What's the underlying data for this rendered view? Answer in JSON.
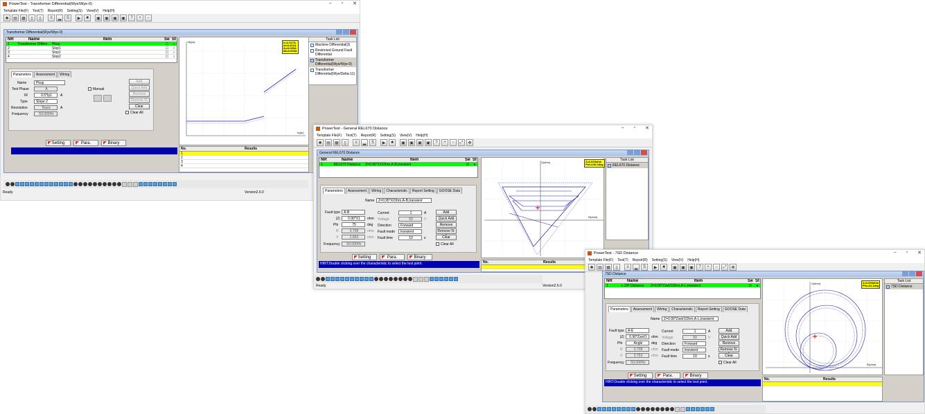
{
  "win1": {
    "title": "PowerTest - Transformer Differential(Wye/Wye-0)",
    "menu": [
      "Template File(F)",
      "Test(T)",
      "Report(R)",
      "Setting(S)",
      "View(V)",
      "Help(H)"
    ],
    "mdi_title": "Transformer Differential(Wye/Wye-0)",
    "grid_headers": {
      "nr": "NR",
      "name": "Name",
      "item": "Item",
      "sel": "Sel",
      "st": "St"
    },
    "rows": [
      {
        "nr": "1",
        "name": "Transformer Differe...",
        "item": "Pkup"
      },
      {
        "nr": "2",
        "name": "",
        "item": "Slop1"
      },
      {
        "nr": "3",
        "name": "",
        "item": "Slop1"
      },
      {
        "nr": "4",
        "name": "",
        "item": "Slop2"
      }
    ],
    "tabs": [
      "Parameters",
      "Assessment",
      "Wiring"
    ],
    "fields": {
      "name_label": "Name",
      "name_val": "Pkup",
      "phase_label": "Test Phase",
      "phase_val": "A",
      "ir_label": "IR",
      "ir_val": "0.5*Ip1",
      "ir_unit": "A",
      "type_label": "Type",
      "type_val": "Slope 2",
      "res_label": "Resolution",
      "res_val": "Basic",
      "res_unit": "A",
      "freq_label": "Frequency",
      "freq_val": "50.000Hz",
      "manual": "Manual",
      "clearall": "Clear All"
    },
    "btns": [
      "Add",
      "Quick Add",
      "Remove",
      "Remove N-1",
      "Clear"
    ],
    "bottom": [
      "Setting",
      "Para.",
      "Binary"
    ],
    "results": {
      "no": "No.",
      "res": "Results",
      "rows": [
        "1",
        "2",
        "3",
        "4"
      ]
    },
    "tasklist": {
      "title": "Task List",
      "items": [
        "Machine Differential(3)",
        "Restricted Ground Fault Differential",
        "Transformer Differential(Wye/Wye-0)",
        "Transformer Differential(Wye/Delta-11)"
      ]
    },
    "legend": [
      "Ir=2.017A",
      "Id=0.611A",
      "Ih=0.000A",
      "IM=0.000A"
    ],
    "chart": {
      "ylabel": "Id(pu)",
      "xlabel": "Ir(pu)",
      "xticks": [
        "0.0",
        "0.5",
        "1.0",
        "1.5",
        "2.0",
        "2.5",
        "3.0",
        "3.5"
      ],
      "yticks": [
        "3.5",
        "3.0",
        "2.5",
        "2.0",
        "1.5",
        "1.0",
        "0.5"
      ]
    },
    "status": "Ready",
    "version": "Version2.6.0"
  },
  "win2": {
    "title": "PowerTest - General REL670 Distance",
    "menu": [
      "Template File(F)",
      "Test(T)",
      "Report(R)",
      "Setting(S)",
      "View(V)",
      "Help(H)"
    ],
    "mdi_title": "General REL670 Distance",
    "row": {
      "nr": "1",
      "name": "REL670 Distance",
      "item": "Z=0.95*1X/Ohm,A-B,transient"
    },
    "tabs": [
      "Parameters",
      "Assessment",
      "Wiring",
      "Characteristic",
      "Report Setting",
      "GOOSE Data"
    ],
    "name_label": "Name",
    "name_val": "Z=0.95*X/Ohm,A-B,transient",
    "labels": {
      "fault": "Fault type",
      "z": "|Z|",
      "phi": "Phi",
      "r": "R",
      "x": "X",
      "freq": "Frequency",
      "current": "Current",
      "voltage": "Voltage",
      "direction": "Direction",
      "mode": "Fault mode",
      "time": "Fault time",
      "clearall": "Clear All"
    },
    "vals": {
      "fault": "A-B",
      "z": "0.90*X1",
      "phi": "75",
      "r": "0.708",
      "x": "2.653",
      "freq": "50.000Hz",
      "current": "1",
      "voltage": "50",
      "direction": "Forward",
      "mode": "transient",
      "time": "10"
    },
    "units": {
      "z": "ohm",
      "phi": "deg",
      "r": "ohm",
      "x": "ohm",
      "current": "A",
      "voltage": "V",
      "time": "s"
    },
    "btns": [
      "Add",
      "Quick Add",
      "Remove",
      "Remove N-1",
      "Clear"
    ],
    "bottom": [
      "Setting",
      "Para.",
      "Binary"
    ],
    "hint": "HINT:Double clicking over the characteristic to select the test point.",
    "results": {
      "no": "No.",
      "res": "Results"
    },
    "tasklist": {
      "title": "Task List",
      "items": [
        "REL670 Distance"
      ]
    },
    "legend": [
      "Z=2.620ohm",
      "Phi=140.0deg"
    ],
    "xlabel": "R(ohm)",
    "ylabel": "X(ohm)",
    "status": "Ready",
    "version": "Version2.6.0"
  },
  "win3": {
    "title": "PowerTest - 7SD Distance",
    "menu": [
      "Template File(F)",
      "Test(T)",
      "Report(R)",
      "Setting(S)",
      "View(V)",
      "Help(H)"
    ],
    "mdi_title": "7SD Distance",
    "row": {
      "nr": "1",
      "name": "L-Z/P Distance",
      "item": "Z=0.90*Zset/1Ohm,A-L,transient"
    },
    "tabs": [
      "Parameters",
      "Assessment",
      "Wiring",
      "Characteristic",
      "Report Setting",
      "GOOSE Data"
    ],
    "name_label": "Name",
    "name_val": "Z=0.90*Zset/1Ohm,A-L,transient",
    "labels": {
      "fault": "Fault type",
      "z": "|Z|",
      "phi": "Phi",
      "r": "R",
      "x": "X",
      "freq": "Frequency",
      "current": "Current",
      "voltage": "Voltage",
      "direction": "Direction",
      "mode": "Fault mode",
      "time": "Fault time",
      "clearall": "Clear All"
    },
    "vals": {
      "fault": "A-E",
      "z": "0.90*Zset/1",
      "phi": "Angle",
      "r": "0.708",
      "x": "2.753",
      "freq": "50.000Hz",
      "current": "1",
      "voltage": "50",
      "direction": "Forward",
      "mode": "transient",
      "time": "10"
    },
    "units": {
      "z": "ohm",
      "phi": "deg",
      "r": "ohm",
      "x": "ohm",
      "current": "A",
      "voltage": "V",
      "time": "s"
    },
    "btns": [
      "Add",
      "Quick Add",
      "Remove",
      "Remove N-1",
      "Clear"
    ],
    "bottom": [
      "Setting",
      "Para.",
      "Binary"
    ],
    "hint": "HINT:Double clicking over the characteristic to select the test point.",
    "results": {
      "no": "No.",
      "res": "Results"
    },
    "tasklist": {
      "title": "Task List",
      "items": [
        "7SD Distance"
      ]
    },
    "legend": [
      "Z=3.000ohm",
      "Phi=44.1deg"
    ],
    "xlabel": "R(ohm)",
    "ylabel": "X(ohm)"
  }
}
